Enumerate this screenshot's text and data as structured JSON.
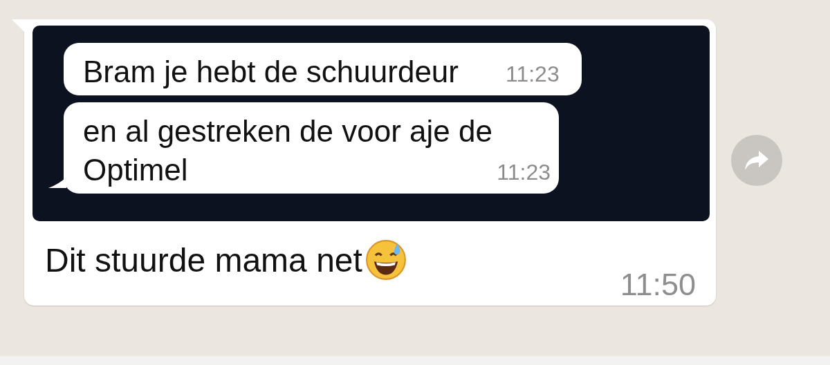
{
  "message": {
    "image": {
      "messages": [
        {
          "text": "Bram je hebt de schuurdeur",
          "time": "11:23",
          "tail": false
        },
        {
          "text": "en al gestreken de voor aje de Optimel",
          "time": "11:23",
          "tail": true
        }
      ]
    },
    "caption": "Dit stuurde mama net",
    "time": "11:50"
  }
}
